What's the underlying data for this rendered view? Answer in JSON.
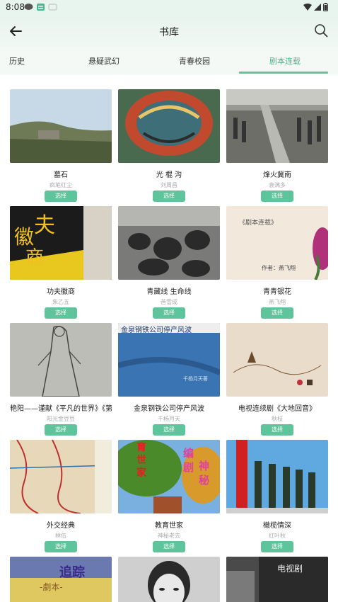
{
  "status": {
    "time": "8:08"
  },
  "header": {
    "title": "书库"
  },
  "tabs": [
    {
      "label": "历史",
      "active": false
    },
    {
      "label": "悬疑武幻",
      "active": false
    },
    {
      "label": "青春校园",
      "active": false
    },
    {
      "label": "剧本连载",
      "active": true
    }
  ],
  "select_label": "选择",
  "books": [
    {
      "title": "墓石",
      "author": "疯笔红尘"
    },
    {
      "title": "光 棍 沟",
      "author": "刘周昌"
    },
    {
      "title": "烽火冀南",
      "author": "袁满多"
    },
    {
      "title": "功夫徽商",
      "author": "朱乙五",
      "cover_text": [
        "夫",
        "徽",
        "商"
      ]
    },
    {
      "title": "青藏线 生命线",
      "author": "苦雪成"
    },
    {
      "title": "青青银花",
      "author": "燕飞翔",
      "cover_text": [
        "《剧本连载》",
        "作者：燕飞翔"
      ]
    },
    {
      "title": "艳阳——谨献《平凡的世界》《第",
      "author": "阳光金豆豆"
    },
    {
      "title": "金泉钢铁公司停产风波",
      "author": "千杨月天",
      "cover_text": [
        "金泉钢铁公司停产风波",
        "千杨月天著"
      ]
    },
    {
      "title": "电视连续剧《大地回音》",
      "author": "秋枝"
    },
    {
      "title": "外交经典",
      "author": "林伍"
    },
    {
      "title": "教育世家",
      "author": "神秘老去",
      "cover_text": [
        "育",
        "世",
        "家",
        "编",
        "剧",
        "神",
        "秘"
      ]
    },
    {
      "title": "橄榄情深",
      "author": "红叶秋"
    },
    {
      "title": "",
      "author": "",
      "cover_text": [
        "追踪",
        "-劇本-"
      ]
    },
    {
      "title": "",
      "author": ""
    },
    {
      "title": "",
      "author": "",
      "cover_text": [
        "电视剧"
      ]
    }
  ],
  "colors": {
    "accent": "#5ec49b",
    "tab_active": "#4fb58e"
  }
}
